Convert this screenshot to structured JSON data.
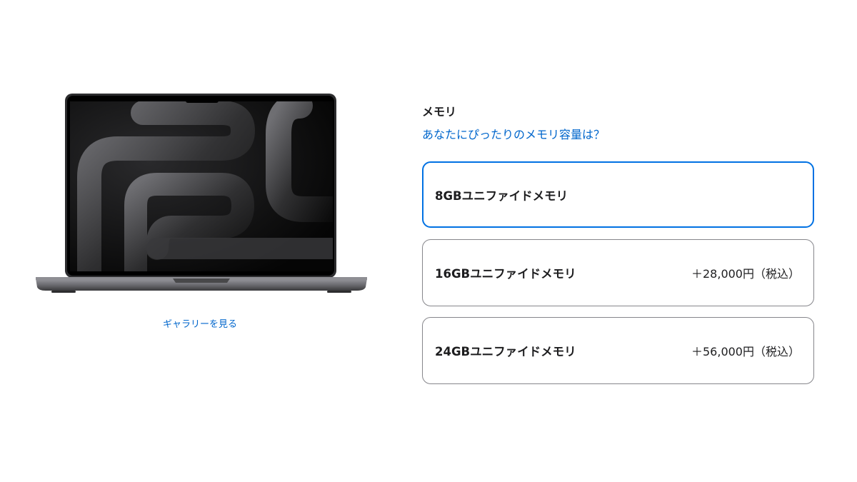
{
  "gallery": {
    "link_label": "ギャラリーを見る"
  },
  "memory": {
    "heading": "メモリ",
    "help_link": "あなたにぴったりのメモリ容量は？",
    "options": [
      {
        "label": "8GBユニファイドメモリ",
        "price": "",
        "selected": true
      },
      {
        "label": "16GBユニファイドメモリ",
        "price": "＋28,000円（税込）",
        "selected": false
      },
      {
        "label": "24GBユニファイドメモリ",
        "price": "＋56,000円（税込）",
        "selected": false
      }
    ]
  },
  "colors": {
    "accent": "#0071e3",
    "link": "#0066cc",
    "text": "#1d1d1f",
    "border": "#86868b"
  }
}
